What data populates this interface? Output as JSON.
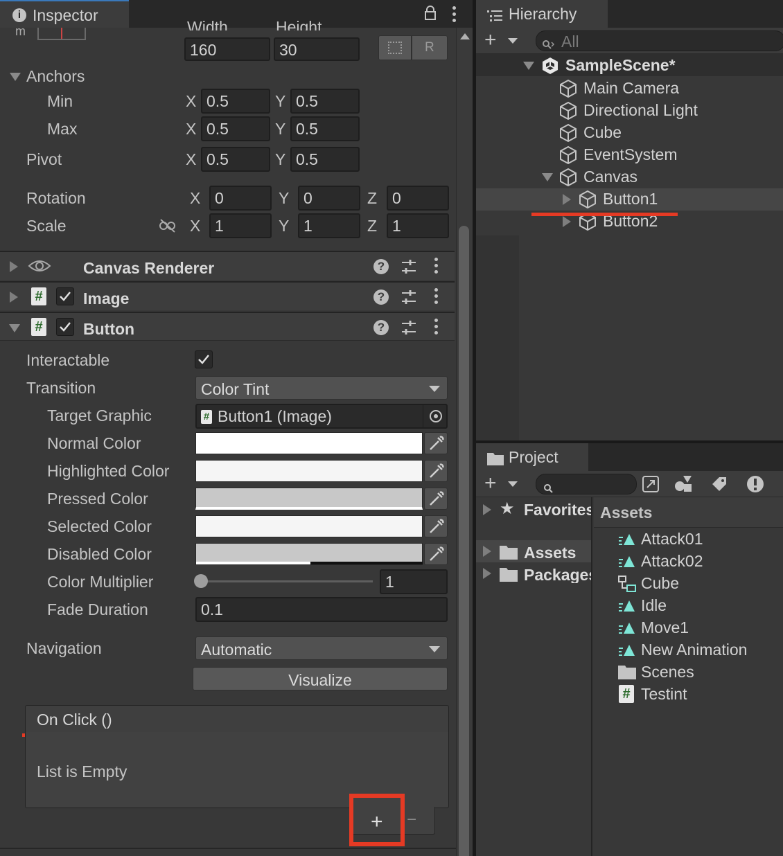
{
  "inspector": {
    "tab_label": "Inspector",
    "rect": {
      "width_label": "Width",
      "height_label": "Height",
      "width_value": "160",
      "height_value": "30",
      "raw_button": "R"
    },
    "anchors": {
      "label": "Anchors",
      "min_label": "Min",
      "max_label": "Max",
      "min_x": "0.5",
      "min_y": "0.5",
      "max_x": "0.5",
      "max_y": "0.5"
    },
    "pivot": {
      "label": "Pivot",
      "x": "0.5",
      "y": "0.5"
    },
    "rotation": {
      "label": "Rotation",
      "x": "0",
      "y": "0",
      "z": "0"
    },
    "scale": {
      "label": "Scale",
      "x": "1",
      "y": "1",
      "z": "1"
    },
    "axis": {
      "x": "X",
      "y": "Y",
      "z": "Z"
    },
    "components": {
      "canvas_renderer": "Canvas Renderer",
      "image": "Image",
      "button": "Button"
    },
    "button": {
      "interactable_label": "Interactable",
      "transition_label": "Transition",
      "transition_value": "Color Tint",
      "target_graphic_label": "Target Graphic",
      "target_graphic_value": "Button1 (Image)",
      "normal_color_label": "Normal Color",
      "highlighted_color_label": "Highlighted Color",
      "pressed_color_label": "Pressed Color",
      "selected_color_label": "Selected Color",
      "disabled_color_label": "Disabled Color",
      "color_multiplier_label": "Color Multiplier",
      "color_multiplier_value": "1",
      "fade_duration_label": "Fade Duration",
      "fade_duration_value": "0.1",
      "navigation_label": "Navigation",
      "navigation_value": "Automatic",
      "visualize_label": "Visualize"
    },
    "on_click": {
      "title": "On Click ()",
      "empty_text": "List is Empty",
      "add_label": "+",
      "remove_label": "−"
    }
  },
  "hierarchy": {
    "tab_label": "Hierarchy",
    "search_placeholder": "All",
    "scene_name": "SampleScene*",
    "items": [
      "Main Camera",
      "Directional Light",
      "Cube",
      "EventSystem",
      "Canvas",
      "Button1",
      "Button2"
    ]
  },
  "project": {
    "tab_label": "Project",
    "tree": [
      "Favorites",
      "Assets",
      "Packages"
    ],
    "assets_header": "Assets",
    "assets": [
      "Attack01",
      "Attack02",
      "Cube",
      "Idle",
      "Move1",
      "New Animation",
      "Scenes",
      "Testint"
    ]
  },
  "colors": {
    "highlight_red": "#e53a24",
    "panel_bg": "#383838",
    "header_bg": "#3d3d3d",
    "anim_icon": "#7ee5d6"
  }
}
